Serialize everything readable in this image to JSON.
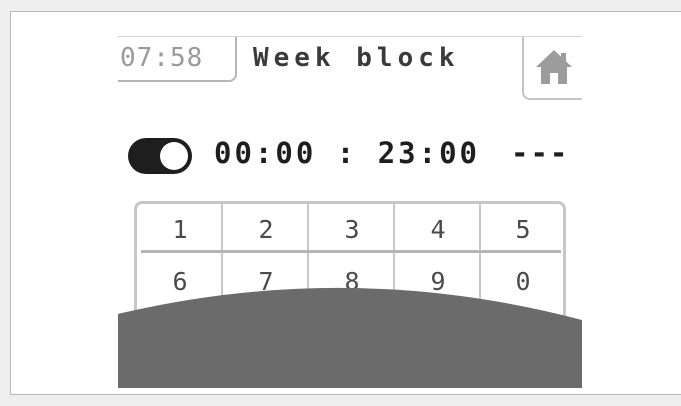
{
  "header": {
    "time": "07:58",
    "title": "Week block",
    "home_icon": "home-icon"
  },
  "schedule": {
    "toggle_state": "on",
    "start_time": "00:00",
    "separator": ":",
    "end_time": "23:00",
    "end_value": "---"
  },
  "keypad": {
    "keys": [
      "1",
      "2",
      "3",
      "4",
      "5",
      "6",
      "7",
      "8",
      "9",
      "0"
    ]
  },
  "colors": {
    "panel_bg": "#ffffff",
    "dark": "#1e1e1e",
    "overlay": "#6b6b6b",
    "border": "#c7c7c7"
  }
}
